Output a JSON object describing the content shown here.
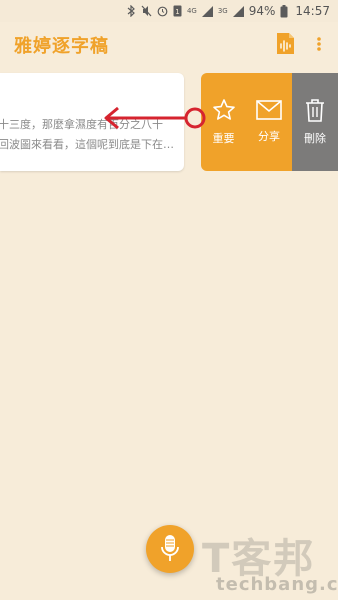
{
  "status_bar": {
    "battery_percent": "94%",
    "time": "14:57",
    "network_4g": "4G",
    "network_3g": "3G"
  },
  "app": {
    "title": "雅婷逐字稿"
  },
  "note": {
    "lines": [
      "十三度，那麼拿濕度有百分之八十",
      "回波圖來看看，這個呢到底是下在…"
    ]
  },
  "swipe_actions": [
    {
      "label": "重要",
      "icon": "star-icon"
    },
    {
      "label": "分享",
      "icon": "mail-icon"
    },
    {
      "label": "刪除",
      "icon": "trash-icon"
    }
  ],
  "colors": {
    "accent": "#f0a22a",
    "background": "#f7ecd9",
    "delete": "#7c7b7a",
    "annotation": "#d6242f"
  },
  "watermark": {
    "logo": "T客邦",
    "text": "techbang.com"
  }
}
